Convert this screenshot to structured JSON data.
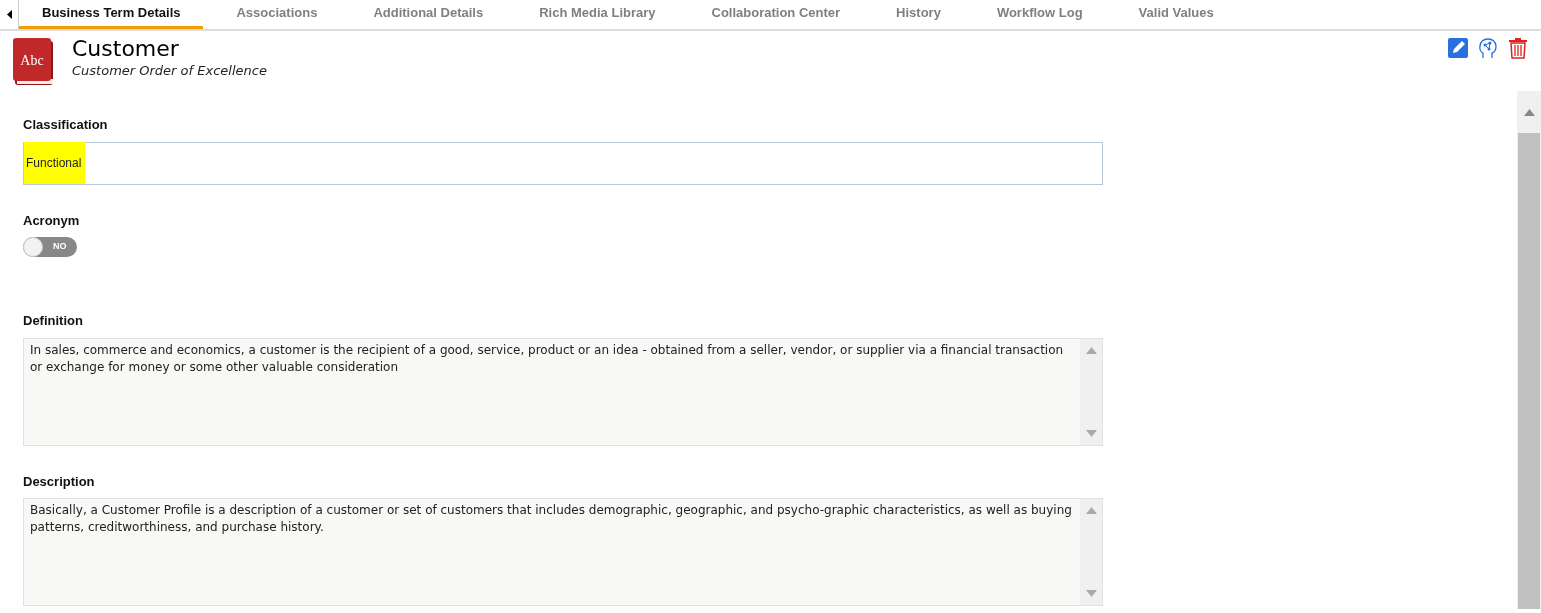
{
  "tabs": [
    {
      "label": "Business Term Details",
      "selected": true
    },
    {
      "label": "Associations",
      "selected": false
    },
    {
      "label": "Additional Details",
      "selected": false
    },
    {
      "label": "Rich Media Library",
      "selected": false
    },
    {
      "label": "Collaboration Center",
      "selected": false
    },
    {
      "label": "History",
      "selected": false
    },
    {
      "label": "Workflow Log",
      "selected": false
    },
    {
      "label": "Valid Values",
      "selected": false
    }
  ],
  "header": {
    "title": "Customer",
    "subtitle": "Customer Order of Excellence",
    "icon_text": "Abc"
  },
  "fields": [
    {
      "kind": "input",
      "label": "Classification",
      "value": "Functional",
      "highlighted": true
    },
    {
      "kind": "toggle",
      "label": "Acronym",
      "on": false,
      "toggle_text": "NO"
    },
    {
      "kind": "textarea",
      "label": "Definition",
      "value": "In sales, commerce and economics, a customer is the recipient of a good, service, product or an idea - obtained from a seller, vendor, or supplier via a financial transaction or exchange for money or some other valuable consideration"
    },
    {
      "kind": "textarea",
      "label": "Description",
      "value": "Basically, a Customer Profile is a description of a customer or set of customers that includes demographic, geographic, and psycho-graphic characteristics, as well as buying patterns, creditworthiness, and purchase history."
    }
  ]
}
